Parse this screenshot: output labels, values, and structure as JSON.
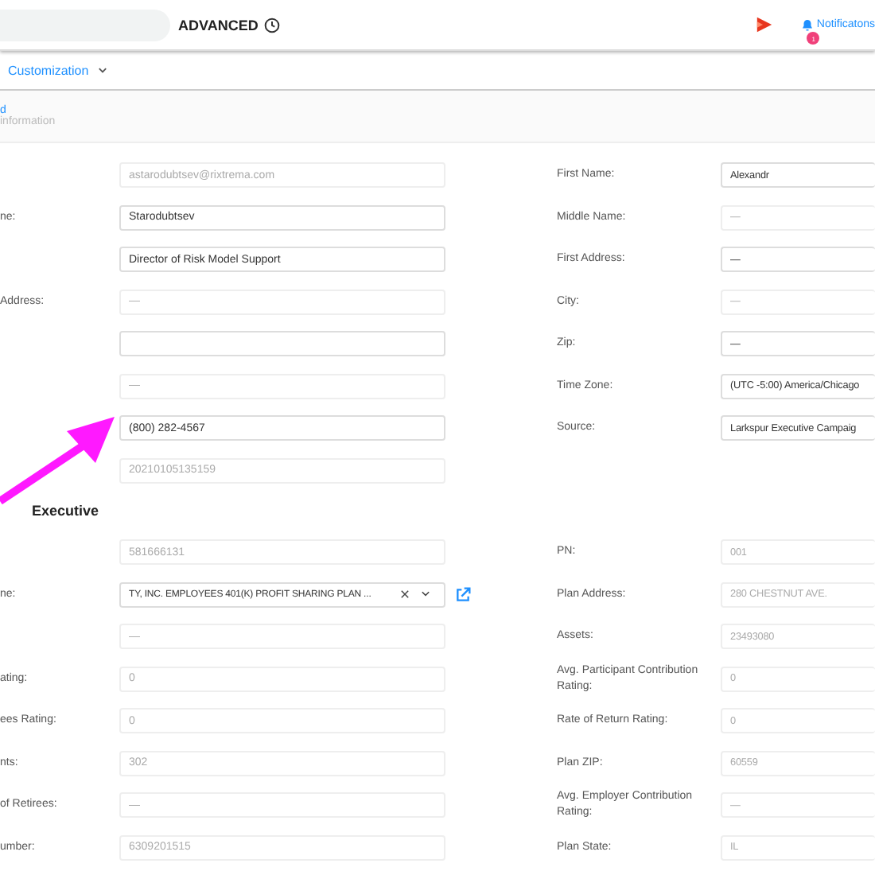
{
  "header": {
    "title": "ADVANCED",
    "notifications": {
      "label": "Notificatons",
      "badge": "1"
    }
  },
  "tabs": [
    {
      "label": "Customization",
      "selected": true
    }
  ],
  "breadcrumb": {
    "link": "d",
    "subtitle": "information"
  },
  "sections": [
    {
      "left": [
        {
          "value": "astarodubtsev@rixtrema.com",
          "disabled": true
        },
        {
          "label": "ne:",
          "value": "Starodubtsev",
          "disabled": false
        },
        {
          "value": "Director of Risk Model Support",
          "disabled": false
        },
        {
          "label": "Address:",
          "value": "—",
          "disabled": true
        },
        {
          "disabled": false
        },
        {
          "value": "—",
          "disabled": true
        },
        {
          "value": "(800) 282-4567",
          "disabled": false
        },
        {
          "value": "20210105135159",
          "disabled": true
        }
      ],
      "right": [
        {
          "label": "First Name:",
          "value": "Alexandr",
          "disabled": false
        },
        {
          "label": "Middle Name:",
          "value": "—",
          "disabled": true
        },
        {
          "label": "First Address:",
          "value": "—",
          "disabled": false
        },
        {
          "label": "City:",
          "value": "—",
          "disabled": true
        },
        {
          "label": "Zip:",
          "value": "—",
          "disabled": false
        },
        {
          "label": "Time Zone:",
          "value": "(UTC -5:00) America/Chicago",
          "disabled": false
        },
        {
          "label": "Source:",
          "value": "Larkspur Executive Campaig",
          "disabled": false
        }
      ]
    },
    {
      "title": "Executive",
      "left": [
        {
          "value": "581666131",
          "disabled": true
        },
        {
          "label": "ne:",
          "value": "TY, INC. EMPLOYEES 401(K) PROFIT SHARING PLAN ...",
          "disabled": false,
          "kind": "select"
        },
        {
          "value": "—",
          "disabled": true
        },
        {
          "label": "ating:",
          "value": "0",
          "disabled": true
        },
        {
          "label": "ees Rating:",
          "value": "0",
          "disabled": true
        },
        {
          "label": "nts:",
          "value": "302",
          "disabled": true
        },
        {
          "label": "of Retirees:",
          "value": "—",
          "disabled": true
        },
        {
          "label": "umber:",
          "value": "6309201515",
          "disabled": true
        }
      ],
      "right": [
        {
          "label": "PN:",
          "value": "001",
          "disabled": true
        },
        {
          "label": "Plan Address:",
          "value": "280 CHESTNUT AVE.",
          "disabled": true
        },
        {
          "label": "Assets:",
          "value": "23493080",
          "disabled": true
        },
        {
          "label": "Avg. Participant Contribution Rating:",
          "value": "0",
          "disabled": true
        },
        {
          "label": "Rate of Return Rating:",
          "value": "0",
          "disabled": true
        },
        {
          "label": "Plan ZIP:",
          "value": "60559",
          "disabled": true
        },
        {
          "label": "Avg. Employer Contribution Rating:",
          "value": "—",
          "disabled": true
        },
        {
          "label": "Plan State:",
          "value": "IL",
          "disabled": true
        }
      ]
    }
  ]
}
